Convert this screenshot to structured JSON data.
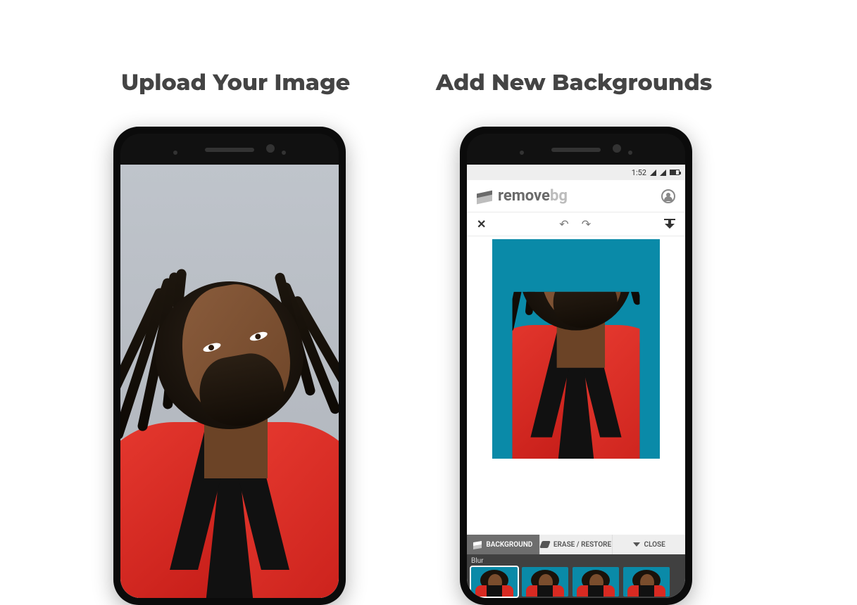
{
  "headings": {
    "left": "Upload Your Image",
    "right": "Add New Backgrounds"
  },
  "statusbar": {
    "time": "1:52"
  },
  "app": {
    "brand_primary": "remove",
    "brand_secondary": "bg"
  },
  "tabs": {
    "background": "BACKGROUND",
    "erase_restore": "ERASE / RESTORE",
    "close": "CLOSE"
  },
  "strip": {
    "label": "Blur"
  },
  "colors": {
    "new_bg": "#0a8aa8",
    "jacket": "#e73a30"
  }
}
